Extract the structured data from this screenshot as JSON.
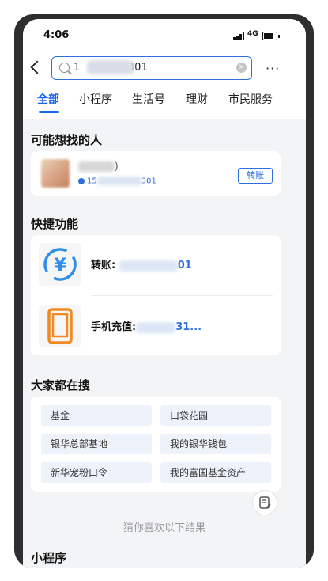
{
  "status_bar": {
    "time": "4:06",
    "network": "4G"
  },
  "search": {
    "value_prefix": "1",
    "value_suffix": "301"
  },
  "more_label": "···",
  "tabs": [
    "全部",
    "小程序",
    "生活号",
    "理财",
    "市民服务"
  ],
  "people": {
    "title": "可能想找的人",
    "name_suffix": ")",
    "phone_prefix": "15",
    "phone_suffix": "301",
    "button": "转账"
  },
  "quick": {
    "title": "快捷功能",
    "items": [
      {
        "label": "转账:",
        "tail": "01",
        "icon": "yen-transfer-icon"
      },
      {
        "label": "手机充值:",
        "tail": "31...",
        "icon": "phone-recharge-icon"
      }
    ]
  },
  "hot": {
    "title": "大家都在搜",
    "items": [
      "基金",
      "口袋花园",
      "银华总部基地",
      "我的银华钱包",
      "新华宠粉口令",
      "我的富国基金资产"
    ]
  },
  "hint": "猜你喜欢以下结果",
  "bottom_section_title": "小程序",
  "colors": {
    "accent": "#1a66e8",
    "phone_frame": "#2e2e30",
    "background": "#f3f4f6"
  }
}
